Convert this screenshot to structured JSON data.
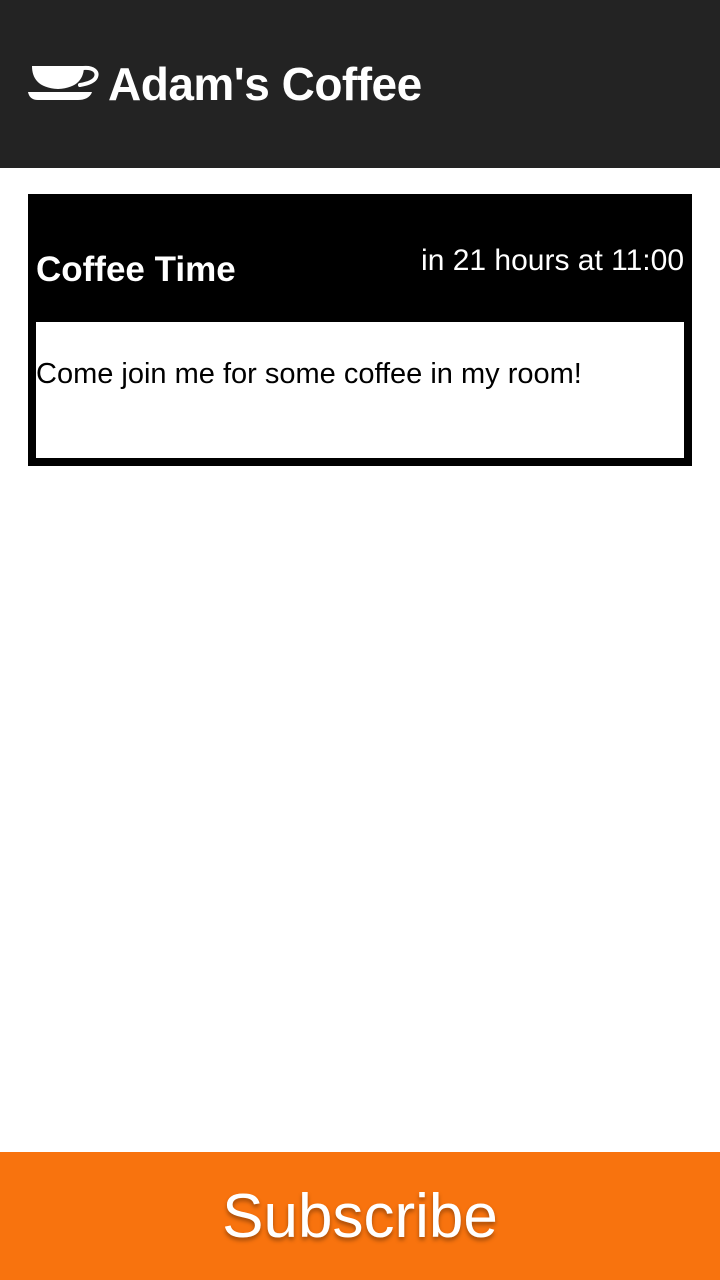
{
  "header": {
    "icon": "coffee-cup-icon",
    "title": "Adam's Coffee",
    "background_color": "#232323"
  },
  "event": {
    "title": "Coffee Time",
    "time": "in 21 hours at 11:00",
    "description": "Come join me for some coffee in my room!"
  },
  "subscribe": {
    "label": "Subscribe",
    "color": "#f8730e"
  }
}
